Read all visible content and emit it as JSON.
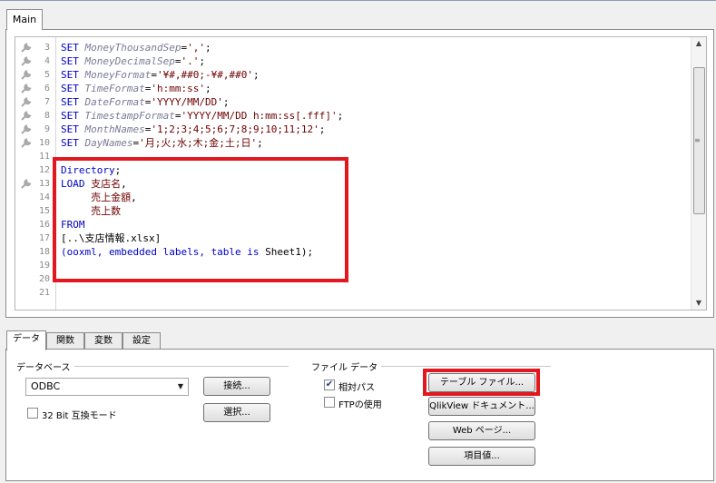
{
  "tabs": {
    "main": "Main"
  },
  "editor": {
    "lines": [
      {
        "n": "3",
        "bp": true,
        "tokens": [
          [
            "kw",
            "SET "
          ],
          [
            "var",
            "MoneyThousandSep"
          ],
          [
            "plain",
            "="
          ],
          [
            "str",
            "','"
          ],
          [
            "plain",
            ";"
          ]
        ]
      },
      {
        "n": "4",
        "bp": true,
        "tokens": [
          [
            "kw",
            "SET "
          ],
          [
            "var",
            "MoneyDecimalSep"
          ],
          [
            "plain",
            "="
          ],
          [
            "str",
            "'.'"
          ],
          [
            "plain",
            ";"
          ]
        ]
      },
      {
        "n": "5",
        "bp": true,
        "tokens": [
          [
            "kw",
            "SET "
          ],
          [
            "var",
            "MoneyFormat"
          ],
          [
            "plain",
            "="
          ],
          [
            "str",
            "'¥#,##0;-¥#,##0'"
          ],
          [
            "plain",
            ";"
          ]
        ]
      },
      {
        "n": "6",
        "bp": true,
        "tokens": [
          [
            "kw",
            "SET "
          ],
          [
            "var",
            "TimeFormat"
          ],
          [
            "plain",
            "="
          ],
          [
            "str",
            "'h:mm:ss'"
          ],
          [
            "plain",
            ";"
          ]
        ]
      },
      {
        "n": "7",
        "bp": true,
        "tokens": [
          [
            "kw",
            "SET "
          ],
          [
            "var",
            "DateFormat"
          ],
          [
            "plain",
            "="
          ],
          [
            "str",
            "'YYYY/MM/DD'"
          ],
          [
            "plain",
            ";"
          ]
        ]
      },
      {
        "n": "8",
        "bp": true,
        "tokens": [
          [
            "kw",
            "SET "
          ],
          [
            "var",
            "TimestampFormat"
          ],
          [
            "plain",
            "="
          ],
          [
            "str",
            "'YYYY/MM/DD h:mm:ss[.fff]'"
          ],
          [
            "plain",
            ";"
          ]
        ]
      },
      {
        "n": "9",
        "bp": true,
        "tokens": [
          [
            "kw",
            "SET "
          ],
          [
            "var",
            "MonthNames"
          ],
          [
            "plain",
            "="
          ],
          [
            "str",
            "'1;2;3;4;5;6;7;8;9;10;11;12'"
          ],
          [
            "plain",
            ";"
          ]
        ]
      },
      {
        "n": "10",
        "bp": true,
        "tokens": [
          [
            "kw",
            "SET "
          ],
          [
            "var",
            "DayNames"
          ],
          [
            "plain",
            "="
          ],
          [
            "str",
            "'月;火;水;木;金;土;日'"
          ],
          [
            "plain",
            ";"
          ]
        ]
      },
      {
        "n": "11",
        "bp": false,
        "tokens": []
      },
      {
        "n": "12",
        "bp": false,
        "tokens": [
          [
            "kw",
            "Directory"
          ],
          [
            "plain",
            ";"
          ]
        ]
      },
      {
        "n": "13",
        "bp": true,
        "tokens": [
          [
            "kw",
            "LOAD "
          ],
          [
            "fld",
            "支店名"
          ],
          [
            "plain",
            ","
          ]
        ]
      },
      {
        "n": "14",
        "bp": false,
        "tokens": [
          [
            "plain",
            "     "
          ],
          [
            "fld",
            "売上金額"
          ],
          [
            "plain",
            ","
          ]
        ]
      },
      {
        "n": "15",
        "bp": false,
        "tokens": [
          [
            "plain",
            "     "
          ],
          [
            "fld",
            "売上数"
          ]
        ]
      },
      {
        "n": "16",
        "bp": false,
        "tokens": [
          [
            "kw",
            "FROM"
          ]
        ]
      },
      {
        "n": "17",
        "bp": false,
        "tokens": [
          [
            "plain",
            "[..\\支店情報.xlsx]"
          ]
        ]
      },
      {
        "n": "18",
        "bp": false,
        "tokens": [
          [
            "kw",
            "(ooxml, embedded labels, table is "
          ],
          [
            "plain",
            "Sheet1);"
          ]
        ]
      },
      {
        "n": "19",
        "bp": false,
        "tokens": []
      },
      {
        "n": "20",
        "bp": false,
        "tokens": []
      },
      {
        "n": "21",
        "bp": false,
        "tokens": []
      }
    ]
  },
  "lower_tabs": [
    "データ",
    "関数",
    "変数",
    "設定"
  ],
  "database": {
    "group_label": "データベース",
    "selected": "ODBC",
    "connect_button": "接続...",
    "select_button": "選択...",
    "bit32_label": "32 Bit 互換モード",
    "bit32_checked": false
  },
  "file_data": {
    "group_label": "ファイル データ",
    "relative_path_label": "相対パス",
    "relative_path_checked": true,
    "ftp_label": "FTPの使用",
    "ftp_checked": false,
    "table_file_button": "テーブル ファイル...",
    "qlikview_doc_button": "QlikView ドキュメント...",
    "web_page_button": "Web ページ...",
    "field_value_button": "項目値..."
  },
  "colors": {
    "highlight_red": "#e3181f",
    "keyword": "#0000c8",
    "string": "#6e0000"
  }
}
